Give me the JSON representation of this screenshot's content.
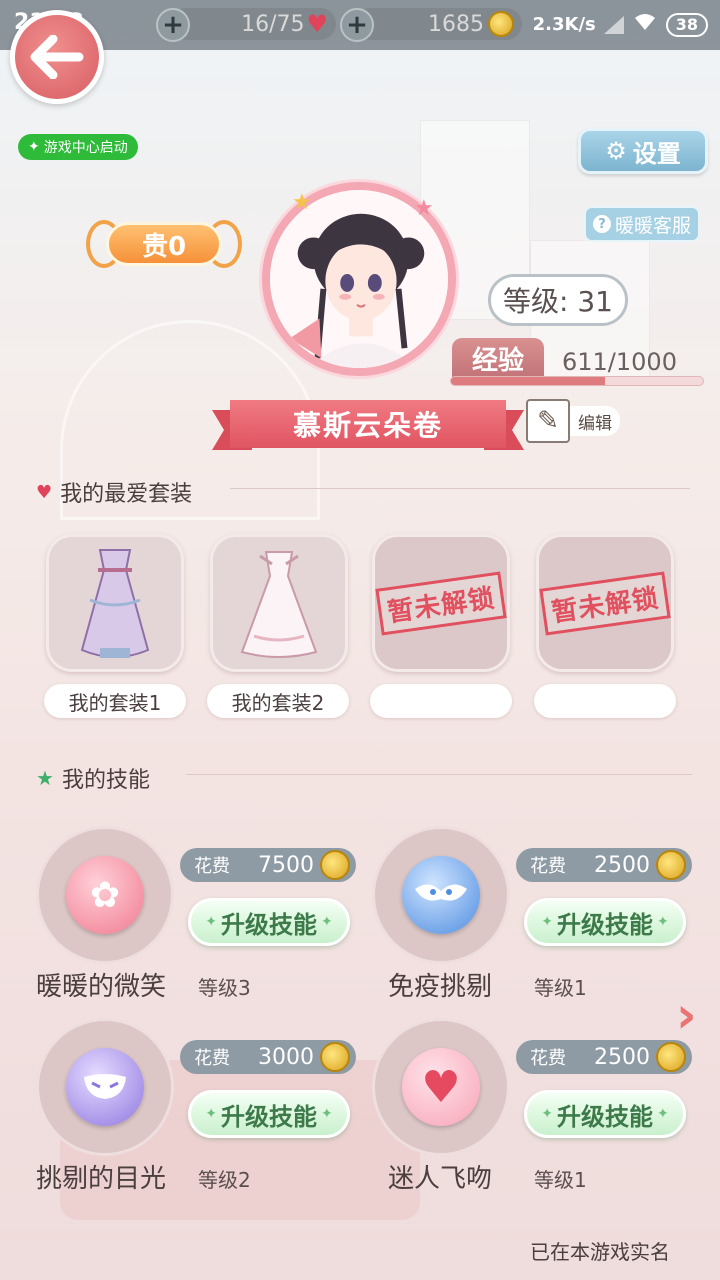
{
  "status_bar": {
    "time": "21:13",
    "stamina": "16/75",
    "coins": "1685",
    "net_speed": "2.3K/s",
    "battery": "38"
  },
  "header": {
    "game_center": "游戏中心启动",
    "settings_label": "设置",
    "service_label": "暖暖客服"
  },
  "profile": {
    "vip": "贵0",
    "level_text": "等级: 31",
    "exp_label": "经验",
    "exp_value": "611/1000",
    "exp_progress": 0.611,
    "name": "慕斯云朵卷",
    "edit_label": "编辑"
  },
  "favorites": {
    "title": "我的最爱套装",
    "cards": [
      {
        "label": "我的套装1",
        "locked": false
      },
      {
        "label": "我的套装2",
        "locked": false
      },
      {
        "label": "",
        "locked": true,
        "stamp": "暂未解锁"
      },
      {
        "label": "",
        "locked": true,
        "stamp": "暂未解锁"
      }
    ]
  },
  "skills": {
    "title": "我的技能",
    "cost_label": "花费",
    "upgrade_label": "升级技能",
    "items": [
      {
        "name": "暖暖的微笑",
        "level": "等级3",
        "cost": "7500",
        "icon": "flower-icon"
      },
      {
        "name": "免疫挑剔",
        "level": "等级1",
        "cost": "2500",
        "icon": "wing-mask-icon"
      },
      {
        "name": "挑剔的目光",
        "level": "等级2",
        "cost": "3000",
        "icon": "mask-icon"
      },
      {
        "name": "迷人飞吻",
        "level": "等级1",
        "cost": "2500",
        "icon": "heart-icon"
      }
    ]
  },
  "footer": {
    "verified": "已在本游戏实名"
  },
  "colors": {
    "ribbon": "#e05562",
    "upgrade_green": "#3d7a4a",
    "accent_pink": "#dd7b7e"
  }
}
